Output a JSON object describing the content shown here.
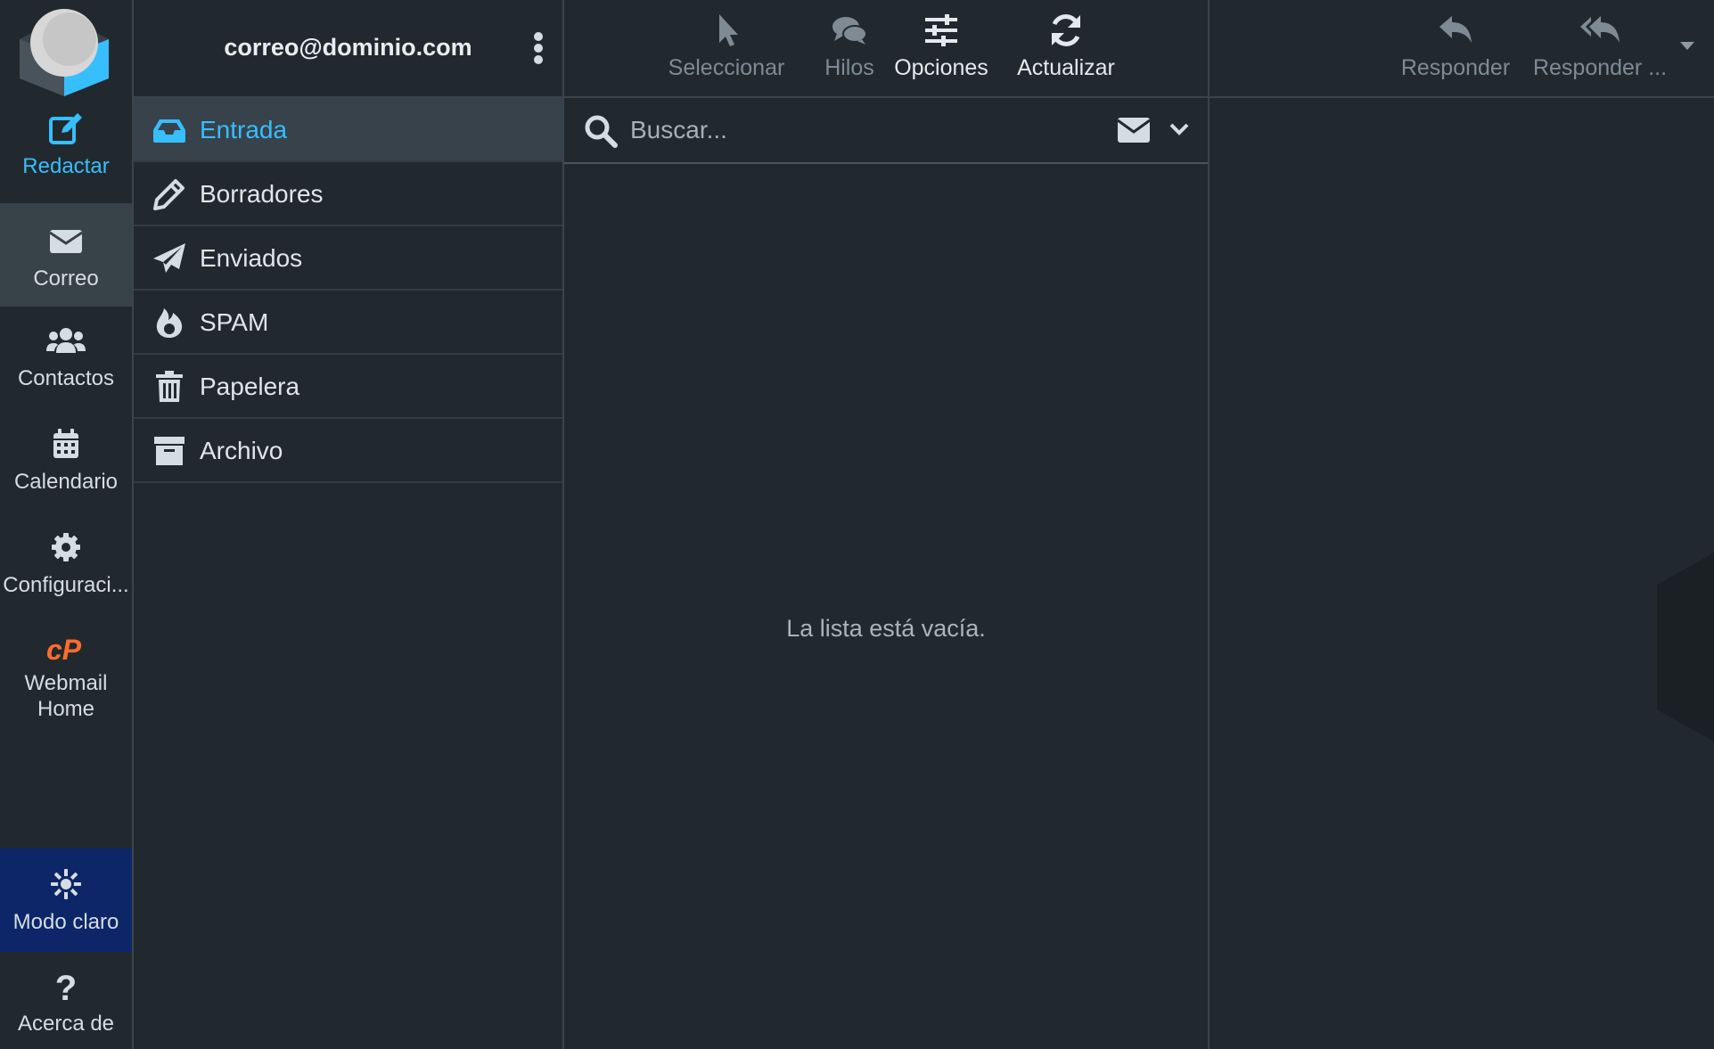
{
  "nav": {
    "compose": "Redactar",
    "mail": "Correo",
    "contacts": "Contactos",
    "calendar": "Calendario",
    "settings": "Configuraci...",
    "webmail_home": [
      "Webmail",
      "Home"
    ],
    "theme_toggle": "Modo claro",
    "about": "Acerca de"
  },
  "account": {
    "email": "correo@dominio.com"
  },
  "folders": [
    {
      "label": "Entrada",
      "icon": "inbox-icon",
      "selected": true
    },
    {
      "label": "Borradores",
      "icon": "pencil-icon",
      "selected": false
    },
    {
      "label": "Enviados",
      "icon": "paper-plane-icon",
      "selected": false
    },
    {
      "label": "SPAM",
      "icon": "fire-icon",
      "selected": false
    },
    {
      "label": "Papelera",
      "icon": "trash-icon",
      "selected": false
    },
    {
      "label": "Archivo",
      "icon": "archive-icon",
      "selected": false
    }
  ],
  "toolbar": {
    "select": "Seleccionar",
    "threads": "Hilos",
    "options": "Opciones",
    "refresh": "Actualizar"
  },
  "search": {
    "placeholder": "Buscar..."
  },
  "message_list": {
    "empty_text": "La lista está vacía."
  },
  "preview_toolbar": {
    "reply": "Responder",
    "reply_all": "Responder ..."
  },
  "colors": {
    "background": "#22292e",
    "accent": "#37beff",
    "selected_row": "#37424a",
    "theme_button": "#0c2668",
    "cpanel_orange": "#ff6c2c"
  }
}
